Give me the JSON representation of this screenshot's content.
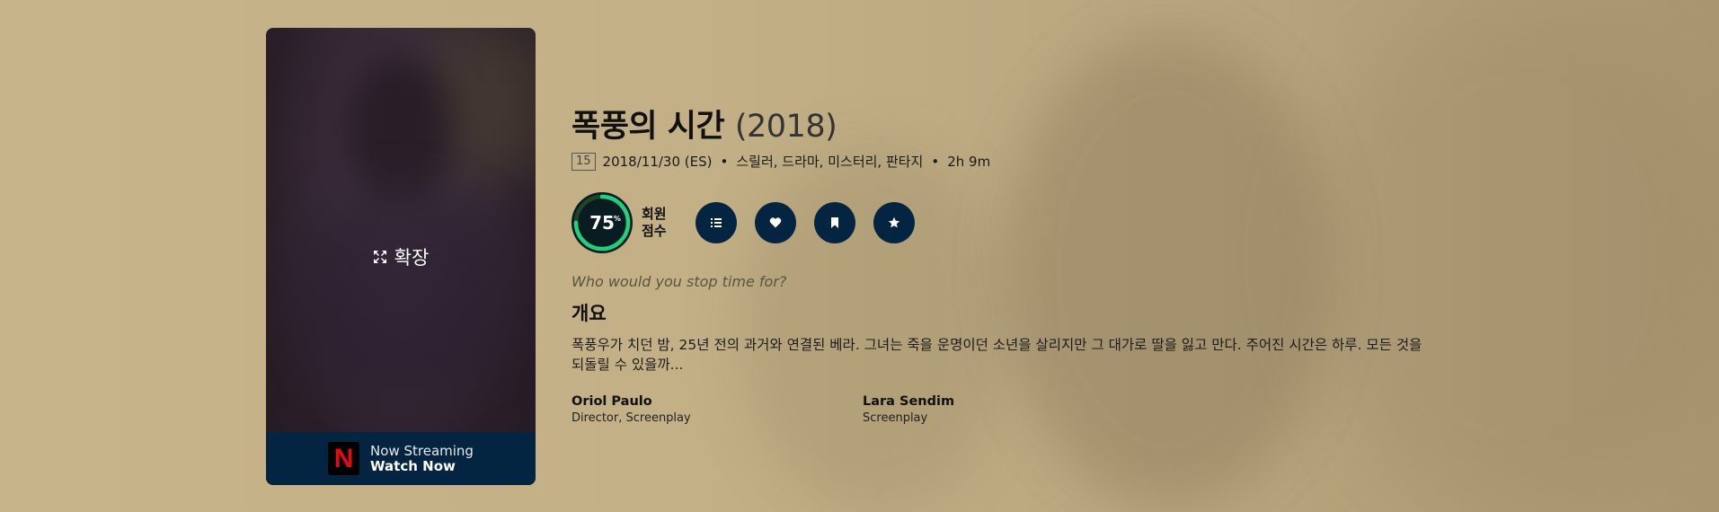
{
  "poster": {
    "expand_label": "확장",
    "streaming_line1": "Now Streaming",
    "streaming_line2": "Watch Now",
    "provider_logo_letter": "N"
  },
  "movie": {
    "title": "폭풍의 시간",
    "year": "(2018)",
    "certification": "15",
    "release": "2018/11/30 (ES)",
    "genres": "스릴러, 드라마, 미스터리, 판타지",
    "runtime": "2h 9m",
    "separator": "•"
  },
  "score": {
    "value": "75",
    "unit": "%",
    "percent": 75,
    "label_line1": "회원",
    "label_line2": "점수",
    "ring_color": "#21d07a",
    "track_color": "#204529"
  },
  "actions": [
    {
      "name": "add-to-list",
      "icon": "list-icon"
    },
    {
      "name": "favorite",
      "icon": "heart-icon"
    },
    {
      "name": "watchlist",
      "icon": "bookmark-icon"
    },
    {
      "name": "rate",
      "icon": "star-icon"
    }
  ],
  "tagline": "Who would you stop time for?",
  "overview_heading": "개요",
  "overview": "폭풍우가 치던 밤, 25년 전의 과거와 연결된 베라. 그녀는 죽을 운명이던 소년을 살리지만 그 대가로 딸을 잃고 만다. 주어진 시간은 하루. 모든 것을 되돌릴 수 있을까...",
  "crew": [
    {
      "name": "Oriol Paulo",
      "role": "Director, Screenplay"
    },
    {
      "name": "Lara Sendim",
      "role": "Screenplay"
    }
  ],
  "colors": {
    "accent_dark": "#032541",
    "score_bg": "#081c22",
    "netflix_red": "#e50914"
  }
}
